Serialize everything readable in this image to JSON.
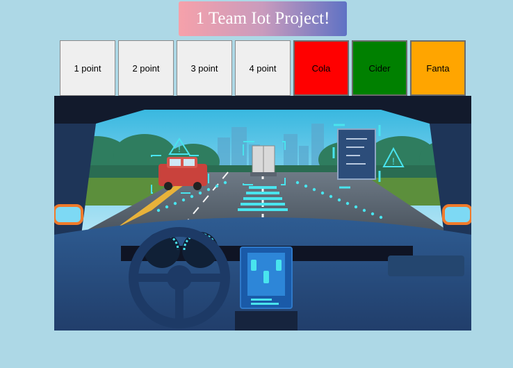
{
  "header": {
    "title": "1 Team Iot Project!"
  },
  "buttons": [
    {
      "label": "1 point",
      "color": "#efefef"
    },
    {
      "label": "2 point",
      "color": "#efefef"
    },
    {
      "label": "3 point",
      "color": "#efefef"
    },
    {
      "label": "4 point",
      "color": "#efefef"
    },
    {
      "label": "Cola",
      "color": "#ff0000"
    },
    {
      "label": "Cider",
      "color": "#008000"
    },
    {
      "label": "Fanta",
      "color": "#ffa500"
    }
  ],
  "colors": {
    "page_background": "#add8e6",
    "title_gradient_start": "#f6a1aa",
    "title_gradient_end": "#5f72c4",
    "hud_cyan": "#49e4ee"
  },
  "scene": {
    "icon": "autonomous-car-dashboard-illustration"
  }
}
